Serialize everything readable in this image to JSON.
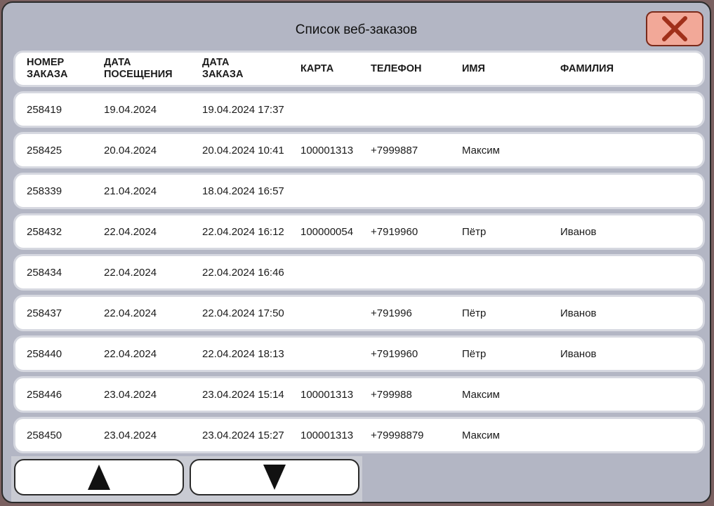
{
  "window": {
    "title": "Список веб-заказов",
    "close_icon": "close-x-icon"
  },
  "table": {
    "headers": [
      "НОМЕР\nЗАКАЗА",
      "ДАТА\nПОСЕЩЕНИЯ",
      "ДАТА\nЗАКАЗА",
      "КАРТА",
      "ТЕЛЕФОН",
      "ИМЯ",
      "ФАМИЛИЯ"
    ],
    "rows": [
      [
        "258419",
        "19.04.2024",
        "19.04.2024 17:37",
        "",
        "",
        "",
        ""
      ],
      [
        "258425",
        "20.04.2024",
        "20.04.2024 10:41",
        "100001313",
        "+7999887",
        "Максим",
        ""
      ],
      [
        "258339",
        "21.04.2024",
        "18.04.2024 16:57",
        "",
        "",
        "",
        ""
      ],
      [
        "258432",
        "22.04.2024",
        "22.04.2024 16:12",
        "100000054",
        "+7919960",
        "Пётр",
        "Иванов"
      ],
      [
        "258434",
        "22.04.2024",
        "22.04.2024 16:46",
        "",
        "",
        "",
        ""
      ],
      [
        "258437",
        "22.04.2024",
        "22.04.2024 17:50",
        "",
        "+791996",
        "Пётр",
        "Иванов"
      ],
      [
        "258440",
        "22.04.2024",
        "22.04.2024 18:13",
        "",
        "+7919960",
        "Пётр",
        "Иванов"
      ],
      [
        "258446",
        "23.04.2024",
        "23.04.2024 15:14",
        "100001313",
        "+799988",
        "Максим",
        ""
      ],
      [
        "258450",
        "23.04.2024",
        "23.04.2024 15:27",
        "100001313",
        "+79998879",
        "Максим",
        ""
      ]
    ]
  },
  "nav": {
    "up_icon": "arrow-up-triangle-icon",
    "down_icon": "arrow-down-triangle-icon"
  },
  "colors": {
    "window_bg": "#b3b6c4",
    "close_bg": "#f2a898",
    "close_icon": "#a0301a",
    "row_bg": "#ffffff"
  }
}
